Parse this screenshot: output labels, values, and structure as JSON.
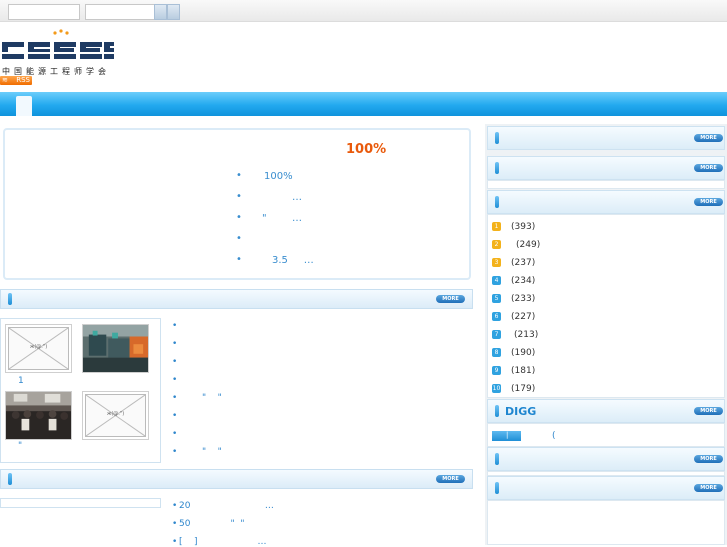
{
  "header": {
    "logo_text": "CSEES",
    "logo_subtitle": "中国能源工程师学会",
    "rss_label": "RSS"
  },
  "more_label": "MORE",
  "promo": {
    "title": "100%",
    "items": [
      "100%",
      "…",
      "\"        …",
      "",
      "3.5     …"
    ]
  },
  "section1": {
    "thumbs": [
      {
        "caption": "",
        "placeholder": "ж(@.\")"
      },
      {
        "caption": "1",
        "placeholder": ""
      },
      {
        "caption": "\"",
        "placeholder": ""
      },
      {
        "caption": "",
        "placeholder": "ж(@.\")"
      }
    ],
    "items": [
      "",
      "",
      "",
      "",
      "\"    \"",
      "",
      "",
      "\"    \""
    ]
  },
  "section2": {
    "items": [
      "20                          …",
      "50              \"  \"",
      "[    ]                     …"
    ]
  },
  "sidebar": {
    "categories": [
      {
        "count": "(393)",
        "color": "#f3b21b"
      },
      {
        "count": "(249)",
        "color": "#f3b21b"
      },
      {
        "count": "(237)",
        "color": "#f3b21b"
      },
      {
        "count": "(234)",
        "color": "#2fa2e0"
      },
      {
        "count": "(233)",
        "color": "#2fa2e0"
      },
      {
        "count": "(227)",
        "color": "#2fa2e0"
      },
      {
        "count": "(213)",
        "color": "#2fa2e0"
      },
      {
        "count": "(190)",
        "color": "#2fa2e0"
      },
      {
        "count": "(181)",
        "color": "#2fa2e0"
      },
      {
        "count": "(179)",
        "color": "#2fa2e0"
      }
    ],
    "digg_title": "DIGG",
    "digg_item": "("
  }
}
